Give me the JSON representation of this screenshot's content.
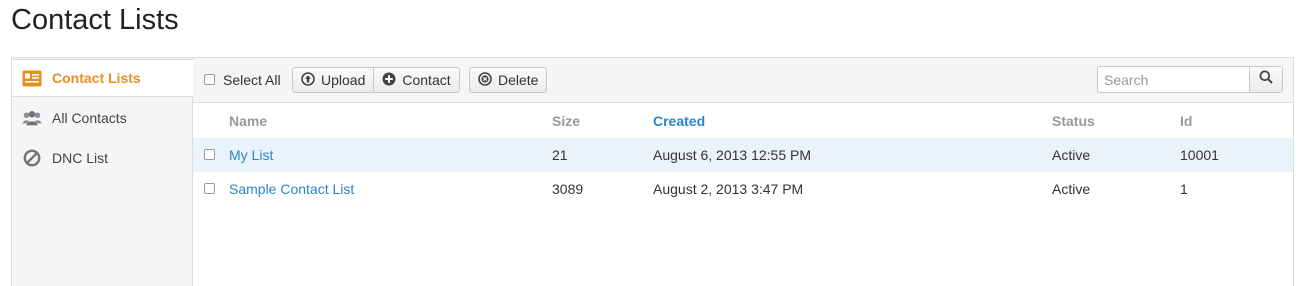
{
  "page": {
    "title": "Contact Lists"
  },
  "sidebar": {
    "items": [
      {
        "label": "Contact Lists",
        "icon": "contact-card-icon",
        "active": true
      },
      {
        "label": "All Contacts",
        "icon": "people-icon",
        "active": false
      },
      {
        "label": "DNC List",
        "icon": "prohibited-icon",
        "active": false
      }
    ]
  },
  "toolbar": {
    "select_all_label": "Select All",
    "upload_label": "Upload",
    "contact_label": "Contact",
    "delete_label": "Delete",
    "search_placeholder": "Search",
    "search_value": ""
  },
  "table": {
    "columns": [
      "Name",
      "Size",
      "Created",
      "Status",
      "Id"
    ],
    "sorted_column": "Created",
    "rows": [
      {
        "name": "My List",
        "size": "21",
        "created": "August 6, 2013 12:55 PM",
        "status": "Active",
        "id": "10001"
      },
      {
        "name": "Sample Contact List",
        "size": "3089",
        "created": "August 2, 2013 3:47 PM",
        "status": "Active",
        "id": "1"
      }
    ]
  },
  "colors": {
    "accent": "#e8901e",
    "link": "#2a86c8",
    "row_highlight": "#eaf2fb"
  }
}
